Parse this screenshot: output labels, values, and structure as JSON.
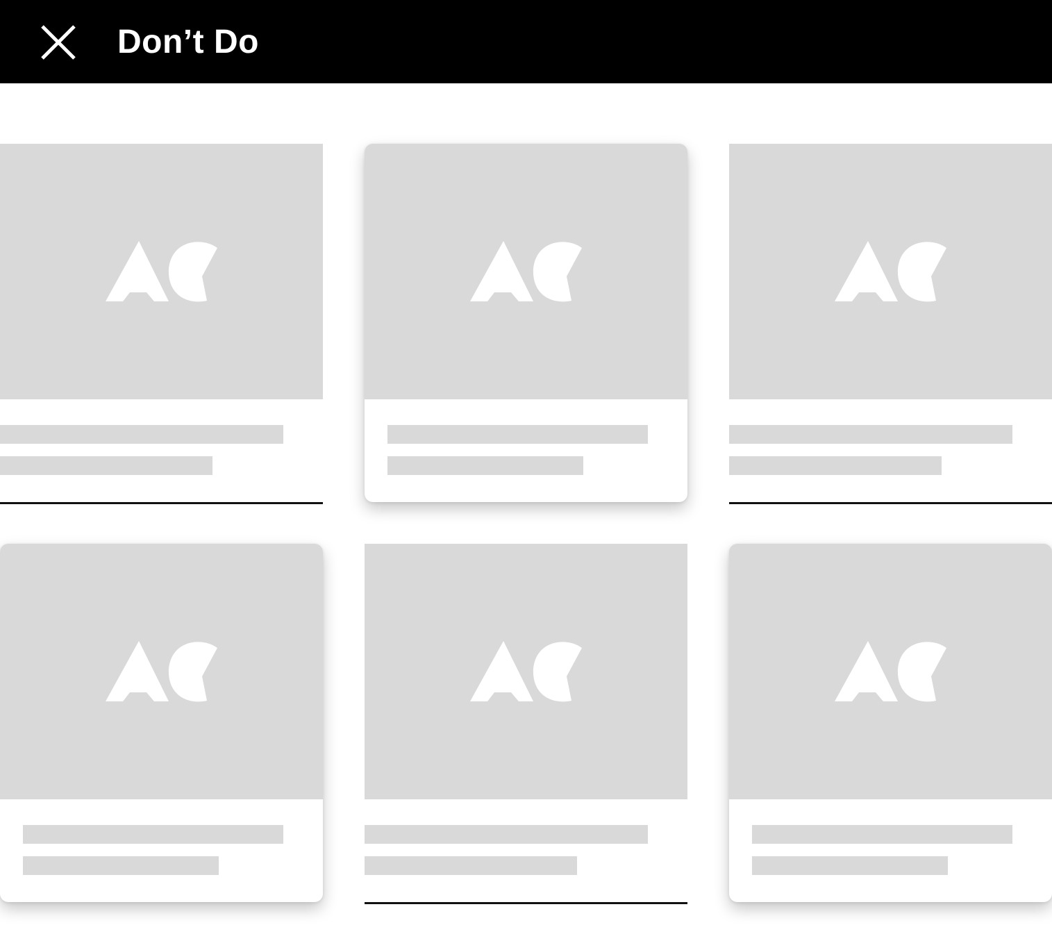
{
  "header": {
    "title": "Don’t Do",
    "background": "#000000",
    "text_color": "#ffffff",
    "close_icon": "close-icon"
  },
  "cards": [
    {
      "style": "flat",
      "logo_icon": "ac-logo-icon"
    },
    {
      "style": "elevated",
      "logo_icon": "ac-logo-icon"
    },
    {
      "style": "flat",
      "logo_icon": "ac-logo-icon"
    },
    {
      "style": "elevated",
      "logo_icon": "ac-logo-icon"
    },
    {
      "style": "flat",
      "logo_icon": "ac-logo-icon"
    },
    {
      "style": "elevated",
      "logo_icon": "ac-logo-icon"
    }
  ],
  "colors": {
    "placeholder": "#d9d9d9",
    "divider": "#111111",
    "card_background": "#ffffff"
  }
}
